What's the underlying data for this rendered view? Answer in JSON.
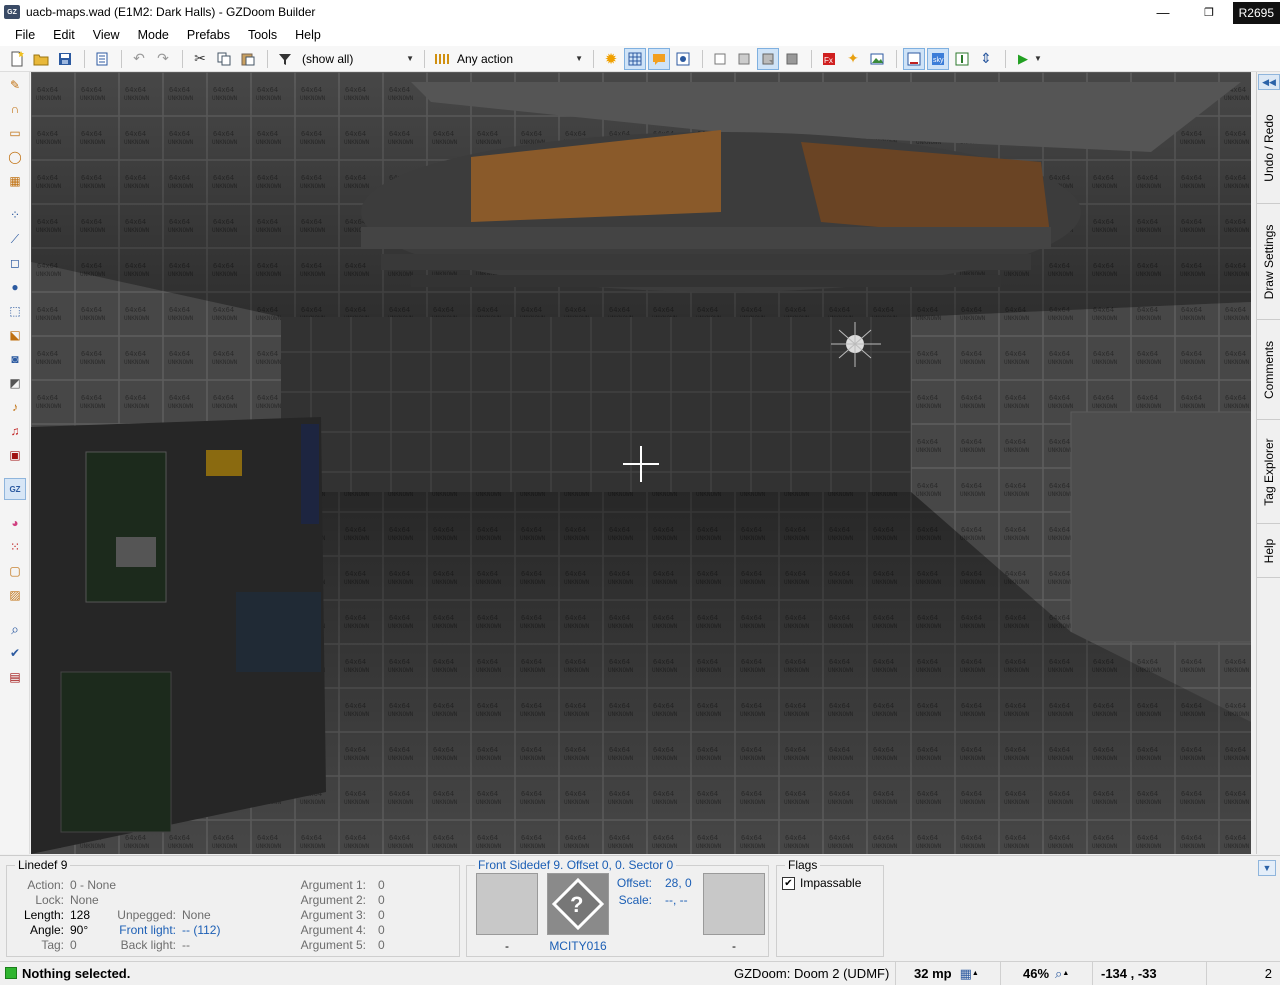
{
  "window": {
    "title": "uacb-maps.wad (E1M2: Dark Halls) - GZDoom Builder",
    "app_icon": "GZ",
    "revision": "R2695",
    "minimize": "—",
    "maximize": "❐",
    "close": "✕"
  },
  "menu": [
    "File",
    "Edit",
    "View",
    "Mode",
    "Prefabs",
    "Tools",
    "Help"
  ],
  "toolbar": {
    "filter_value": "(show all)",
    "action_value": "Any action"
  },
  "left_tools": [
    {
      "name": "draw-lines-icon",
      "glyph": "✎"
    },
    {
      "name": "draw-curve-icon",
      "glyph": "∩"
    },
    {
      "name": "draw-rectangle-icon",
      "glyph": "▭"
    },
    {
      "name": "draw-ellipse-icon",
      "glyph": "◯"
    },
    {
      "name": "draw-grid-icon",
      "glyph": "▦"
    },
    {
      "name": "vertices-mode-icon",
      "glyph": "⁘"
    },
    {
      "name": "linedefs-mode-icon",
      "glyph": "⟋"
    },
    {
      "name": "sectors-mode-icon",
      "glyph": "◻"
    },
    {
      "name": "things-mode-icon",
      "glyph": "●"
    },
    {
      "name": "make-sectors-icon",
      "glyph": "⬚"
    },
    {
      "name": "edit-selection-icon",
      "glyph": "⬕"
    },
    {
      "name": "sound-propagation-icon",
      "glyph": "◙"
    },
    {
      "name": "sound-environment-icon",
      "glyph": "◩"
    },
    {
      "name": "ears-icon",
      "glyph": "♪"
    },
    {
      "name": "ears-z-icon",
      "glyph": "♫"
    },
    {
      "name": "film-icon",
      "glyph": "▣"
    },
    {
      "name": "visual-mode-icon",
      "glyph": "GZ"
    },
    {
      "name": "color-picker-icon",
      "glyph": "◕"
    },
    {
      "name": "snap-vertices-icon",
      "glyph": "⁙"
    },
    {
      "name": "fit-texture-icon",
      "glyph": "▢"
    },
    {
      "name": "paint-icon",
      "glyph": "▨"
    },
    {
      "name": "find-icon",
      "glyph": "⌕"
    },
    {
      "name": "check-map-icon",
      "glyph": "✔"
    },
    {
      "name": "script-icon",
      "glyph": "▤"
    }
  ],
  "dock_tabs": [
    "Undo / Redo",
    "Draw Settings",
    "Comments",
    "Tag Explorer",
    "Help"
  ],
  "linedef": {
    "title": "Linedef 9",
    "action_label": "Action:",
    "action": "0 - None",
    "lock_label": "Lock:",
    "lock": "None",
    "length_label": "Length:",
    "length": "128",
    "angle_label": "Angle:",
    "angle": "90°",
    "tag_label": "Tag:",
    "tag": "0",
    "unpegged_label": "Unpegged:",
    "unpegged": "None",
    "front_light_label": "Front light:",
    "front_light": "-- (112)",
    "back_light_label": "Back light:",
    "back_light": "--",
    "arguments": [
      {
        "label": "Argument 1:",
        "value": "0"
      },
      {
        "label": "Argument 2:",
        "value": "0"
      },
      {
        "label": "Argument 3:",
        "value": "0"
      },
      {
        "label": "Argument 4:",
        "value": "0"
      },
      {
        "label": "Argument 5:",
        "value": "0"
      }
    ]
  },
  "sidedef": {
    "title": "Front Sidedef 9. Offset 0, 0. Sector 0",
    "offset_label": "Offset:",
    "offset": "28, 0",
    "scale_label": "Scale:",
    "scale": "--, --",
    "upper_tex": "-",
    "middle_tex": "MCITY016",
    "lower_tex": "-"
  },
  "flags": {
    "title": "Flags",
    "impassable": "Impassable"
  },
  "status": {
    "text": "Nothing selected.",
    "game": "GZDoom: Doom 2 (UDMF)",
    "grid": "32 mp",
    "zoom": "46%",
    "coords": "-134 , -33",
    "count": "2"
  }
}
